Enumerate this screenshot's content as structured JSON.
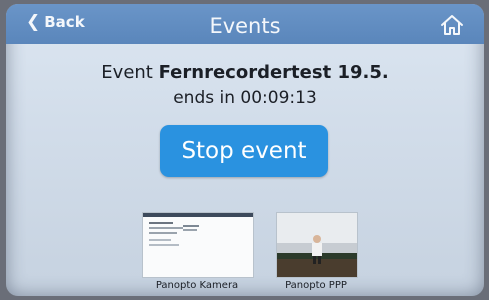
{
  "header": {
    "back_label": "Back",
    "title": "Events"
  },
  "event": {
    "prefix": "Event",
    "name": "Fernrecordertest 19.5.",
    "ends_text": "ends in 00:09:13"
  },
  "actions": {
    "stop_label": "Stop event"
  },
  "sources": [
    {
      "label": "Panopto Kamera"
    },
    {
      "label": "Panopto PPP"
    }
  ],
  "colors": {
    "topbar": "#5a86bb",
    "stop_button": "#2a92e0",
    "background": "#d2ddea"
  },
  "icons": {
    "back": "chevron-left-icon",
    "home": "home-icon"
  }
}
